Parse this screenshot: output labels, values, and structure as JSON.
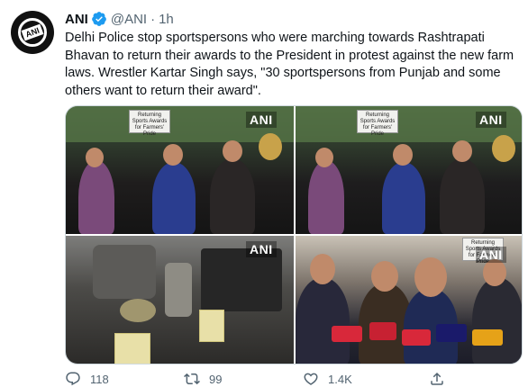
{
  "tweet": {
    "author_name": "ANI",
    "handle": "@ANI",
    "separator": "·",
    "time": "1h",
    "text": "Delhi Police stop sportspersons who were marching towards Rashtrapati Bhavan to return their awards to the President in protest against the new farm laws. Wrestler Kartar Singh says, \"30 sportspersons from Punjab and some others want to return their award\".",
    "avatar_logo": "ANI"
  },
  "media": {
    "watermark": "ANI",
    "sign_text": "Returning Sports Awards for Farmers' Pride"
  },
  "actions": {
    "reply_count": "118",
    "retweet_count": "99",
    "like_count": "1.4K",
    "icons": [
      "reply-icon",
      "retweet-icon",
      "like-icon",
      "share-icon"
    ]
  },
  "colors": {
    "text": "#0f1419",
    "secondary": "#536471",
    "verified": "#1d9bf0"
  }
}
